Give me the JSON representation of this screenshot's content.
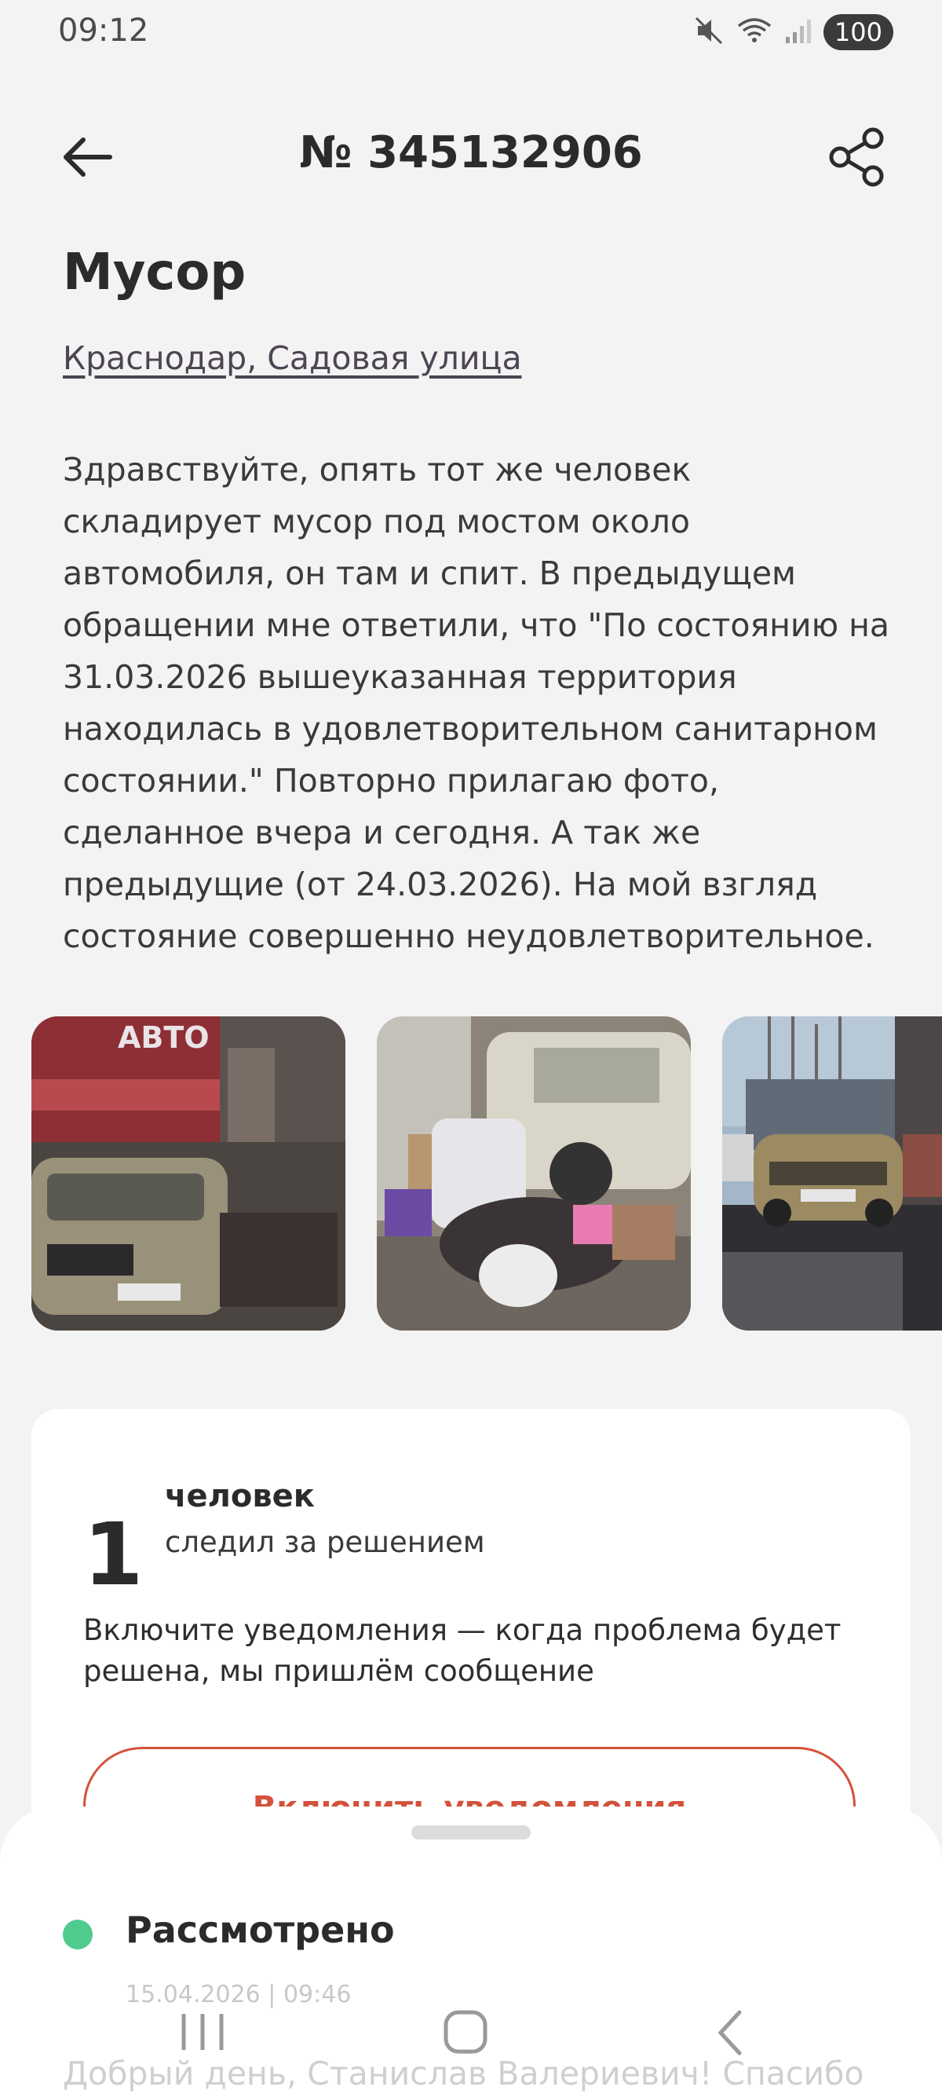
{
  "status_bar": {
    "time": "09:12",
    "battery": "100"
  },
  "header": {
    "ticket_number": "№ 345132906"
  },
  "issue": {
    "title": "Мусор",
    "address": "Краснодар, Садовая улица",
    "description": "Здравствуйте, опять тот же человек складирует мусор под мостом около автомобиля, он там и спит. В предыдущем обращении мне ответили, что \"По состоянию на 31.03.2026 вышеуказанная территория находилась в удовлетворительном санитарном состоянии.\" Повторно прилагаю фото, сделанное вчера и сегодня. А так же предыдущие (от 24.03.2026). На мой взгляд состояние совершенно неудовлетворительное."
  },
  "photos": [
    {
      "caption": "АВТО"
    },
    {
      "caption": ""
    },
    {
      "caption": ""
    }
  ],
  "followers": {
    "count": "1",
    "label": "человек",
    "sublabel": "следил за решением",
    "notify_text": "Включите уведомления — когда проблема будет решена, мы пришлём сообщение",
    "notify_button": "Включить уведомления"
  },
  "status": {
    "title": "Рассмотрено",
    "date": "15.04.2026 | 09:46",
    "reply_preview": "Добрый день, Станислав Валериевич! Спасибо",
    "color": "#4fcb8e"
  },
  "colors": {
    "accent": "#d4513b",
    "background": "#f3f3f3"
  },
  "icons": [
    "back-arrow-icon",
    "share-icon",
    "mute-icon",
    "wifi-icon",
    "signal-icon",
    "recent-apps-icon",
    "home-icon",
    "back-icon"
  ]
}
